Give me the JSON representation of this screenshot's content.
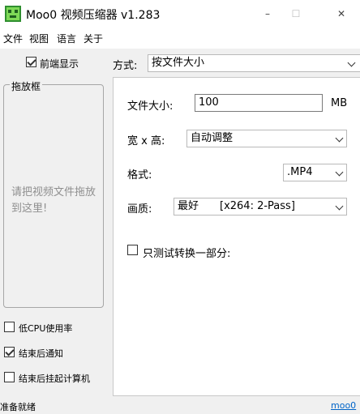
{
  "window": {
    "title": "Moo0 视频压缩器 v1.283",
    "minimize": "–",
    "maximize": "☐",
    "close": "✕"
  },
  "menu": [
    "文件",
    "视图",
    "语言",
    "关于"
  ],
  "left": {
    "preview_label": "前端显示",
    "preview_checked": true,
    "dropzone_title": "拖放框",
    "dropzone_hint": "请把视频文件拖放到这里!",
    "options": [
      {
        "label": "低CPU使用率",
        "checked": false
      },
      {
        "label": "结束后通知",
        "checked": true
      },
      {
        "label": "结束后挂起计算机",
        "checked": false
      }
    ]
  },
  "mode": {
    "label": "方式:",
    "value": "按文件大小"
  },
  "form": {
    "size_label": "文件大小:",
    "size_value": "100",
    "size_unit": "MB",
    "dim_label": "宽 x 高:",
    "dim_value": "自动调整",
    "format_label": "格式:",
    "format_value": ".MP4",
    "quality_label": "画质:",
    "quality_value": "最好",
    "quality_detail": "[x264: 2-Pass]",
    "test_label": "只测试转换一部分:",
    "test_checked": false
  },
  "status": {
    "text": "准备就绪",
    "link": "moo0"
  }
}
